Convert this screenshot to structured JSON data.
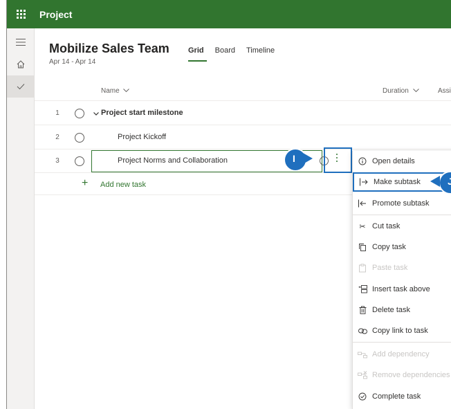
{
  "app": {
    "title": "Project"
  },
  "plan": {
    "title": "Mobilize Sales Team",
    "dates": "Apr 14 - Apr 14"
  },
  "tabs": [
    {
      "label": "Grid",
      "active": true
    },
    {
      "label": "Board",
      "active": false
    },
    {
      "label": "Timeline",
      "active": false
    }
  ],
  "columns": {
    "name": "Name",
    "duration": "Duration",
    "assigned": "Assi"
  },
  "rows": [
    {
      "num": "1",
      "name": "Project start milestone",
      "bold": true
    },
    {
      "num": "2",
      "name": "Project Kickoff",
      "bold": false
    },
    {
      "num": "3",
      "name": "Project Norms and Collaboration",
      "bold": false
    }
  ],
  "add_task": {
    "label": "Add new task"
  },
  "callouts": {
    "i": "I",
    "j": "J"
  },
  "menu": {
    "items": [
      {
        "label": "Open details",
        "icon": "info-icon",
        "disabled": false
      },
      {
        "label": "Make subtask",
        "icon": "indent-icon",
        "disabled": false
      },
      {
        "label": "Promote subtask",
        "icon": "outdent-icon",
        "disabled": false
      },
      {
        "label": "Cut task",
        "icon": "scissors-icon",
        "disabled": false
      },
      {
        "label": "Copy task",
        "icon": "copy-icon",
        "disabled": false
      },
      {
        "label": "Paste task",
        "icon": "paste-icon",
        "disabled": true
      },
      {
        "label": "Insert task above",
        "icon": "insert-above-icon",
        "disabled": false
      },
      {
        "label": "Delete task",
        "icon": "trash-icon",
        "disabled": false
      },
      {
        "label": "Copy link to task",
        "icon": "link-icon",
        "disabled": false
      },
      {
        "label": "Add dependency",
        "icon": "dependency-icon",
        "disabled": true
      },
      {
        "label": "Remove dependencies",
        "icon": "remove-dependency-icon",
        "disabled": true
      },
      {
        "label": "Complete task",
        "icon": "check-circle-icon",
        "disabled": false
      }
    ]
  },
  "colors": {
    "brand": "#31752f",
    "callout": "#1f6fbe"
  }
}
